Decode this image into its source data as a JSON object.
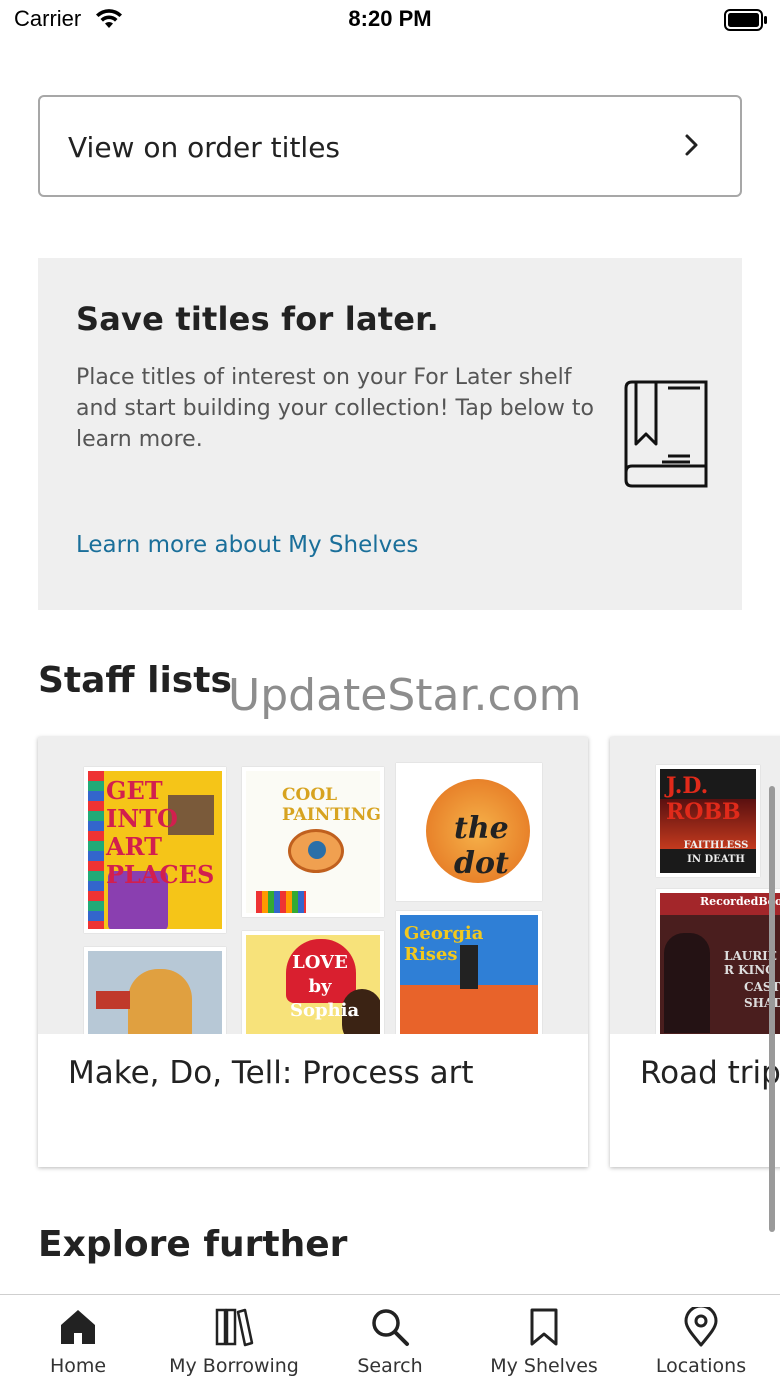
{
  "status_bar": {
    "carrier": "Carrier",
    "time": "8:20 PM"
  },
  "on_order": {
    "label": "View on order titles"
  },
  "promo": {
    "title": "Save titles for later.",
    "body": "Place titles of interest on your For Later shelf and start building your collection! Tap below to learn more.",
    "link": "Learn more about My Shelves",
    "link_color": "#1a6f9a"
  },
  "watermark": "UpdateStar.com",
  "staff_lists": {
    "title": "Staff lists",
    "cards": [
      {
        "title": "Make, Do, Tell: Process art",
        "covers": [
          {
            "text": "GET INTO ART PLACES"
          },
          {
            "text": "COOL PAINTING"
          },
          {
            "text": "the dot"
          },
          {
            "text": ""
          },
          {
            "text": "LOVE by Sophia"
          },
          {
            "text": "Georgia Rises"
          }
        ]
      },
      {
        "title": "Road trip",
        "covers": [
          {
            "text": "J.D. ROBB"
          },
          {
            "text": "FAITHLESS IN DEATH"
          },
          {
            "text": "RecordedBooks"
          },
          {
            "text": "LAURIE R KING"
          },
          {
            "text": "CASTLE SHADE"
          }
        ]
      }
    ]
  },
  "explore": {
    "title": "Explore further"
  },
  "tab_bar": {
    "tabs": [
      {
        "label": "Home",
        "icon": "home-icon"
      },
      {
        "label": "My Borrowing",
        "icon": "books-icon"
      },
      {
        "label": "Search",
        "icon": "search-icon"
      },
      {
        "label": "My Shelves",
        "icon": "bookmark-icon"
      },
      {
        "label": "Locations",
        "icon": "location-pin-icon"
      }
    ]
  }
}
